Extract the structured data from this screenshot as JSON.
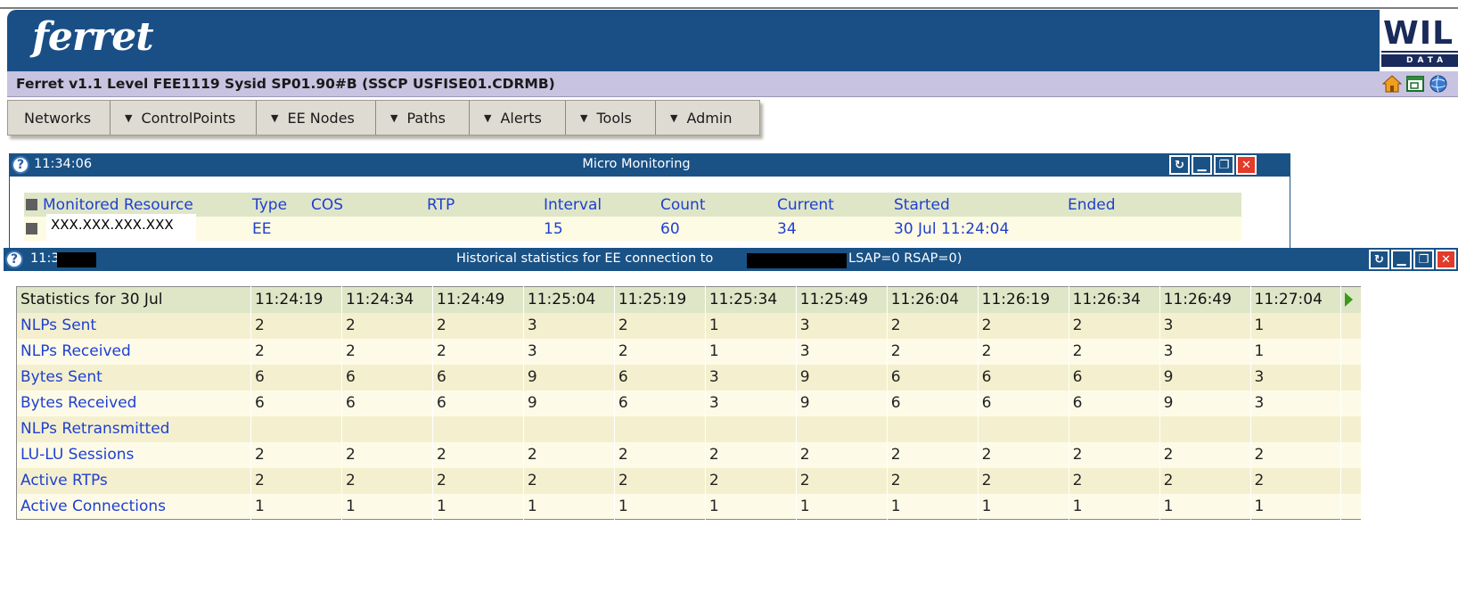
{
  "brand": {
    "logo": "ferret",
    "corp_logo": "WIL",
    "corp_sub": "DATA"
  },
  "status_line": "Ferret v1.1 Level FEE1119 Sysid SP01.90#B (SSCP USFISE01.CDRMB)",
  "header_icons": [
    "home-icon",
    "window-icon",
    "globe-icon"
  ],
  "menu": {
    "items": [
      {
        "label": "Networks",
        "arrow": false
      },
      {
        "label": "ControlPoints",
        "arrow": true
      },
      {
        "label": "EE Nodes",
        "arrow": true
      },
      {
        "label": "Paths",
        "arrow": true
      },
      {
        "label": "Alerts",
        "arrow": true
      },
      {
        "label": "Tools",
        "arrow": true
      },
      {
        "label": "Admin",
        "arrow": true
      }
    ]
  },
  "micro_window": {
    "time": "11:34:06",
    "title": "Micro Monitoring",
    "columns": [
      "Monitored Resource",
      "Type",
      "COS",
      "RTP",
      "Interval",
      "Count",
      "Current",
      "Started",
      "Ended"
    ],
    "row": {
      "resource": "XXX.XXX.XXX.XXX",
      "type": "EE",
      "cos": "",
      "rtp": "",
      "interval": "15",
      "count": "60",
      "current": "34",
      "started": "30 Jul 11:24:04",
      "ended": ""
    }
  },
  "hist_window": {
    "time": "11:34:20",
    "title": "Historical statistics for EE connection to",
    "title_suffix": "LSAP=0 RSAP=0)",
    "header_label": "Statistics for 30 Jul",
    "times": [
      "11:24:19",
      "11:24:34",
      "11:24:49",
      "11:25:04",
      "11:25:19",
      "11:25:34",
      "11:25:49",
      "11:26:04",
      "11:26:19",
      "11:26:34",
      "11:26:49",
      "11:27:04"
    ],
    "rows": [
      {
        "label": "NLPs Sent",
        "values": [
          "2",
          "2",
          "2",
          "3",
          "2",
          "1",
          "3",
          "2",
          "2",
          "2",
          "3",
          "1"
        ]
      },
      {
        "label": "NLPs Received",
        "values": [
          "2",
          "2",
          "2",
          "3",
          "2",
          "1",
          "3",
          "2",
          "2",
          "2",
          "3",
          "1"
        ]
      },
      {
        "label": "Bytes Sent",
        "values": [
          "6",
          "6",
          "6",
          "9",
          "6",
          "3",
          "9",
          "6",
          "6",
          "6",
          "9",
          "3"
        ]
      },
      {
        "label": "Bytes Received",
        "values": [
          "6",
          "6",
          "6",
          "9",
          "6",
          "3",
          "9",
          "6",
          "6",
          "6",
          "9",
          "3"
        ]
      },
      {
        "label": "NLPs Retransmitted",
        "values": [
          "",
          "",
          "",
          "",
          "",
          "",
          "",
          "",
          "",
          "",
          "",
          ""
        ]
      },
      {
        "label": "LU-LU Sessions",
        "values": [
          "2",
          "2",
          "2",
          "2",
          "2",
          "2",
          "2",
          "2",
          "2",
          "2",
          "2",
          "2"
        ]
      },
      {
        "label": "Active RTPs",
        "values": [
          "2",
          "2",
          "2",
          "2",
          "2",
          "2",
          "2",
          "2",
          "2",
          "2",
          "2",
          "2"
        ]
      },
      {
        "label": "Active Connections",
        "values": [
          "1",
          "1",
          "1",
          "1",
          "1",
          "1",
          "1",
          "1",
          "1",
          "1",
          "1",
          "1"
        ]
      }
    ]
  }
}
